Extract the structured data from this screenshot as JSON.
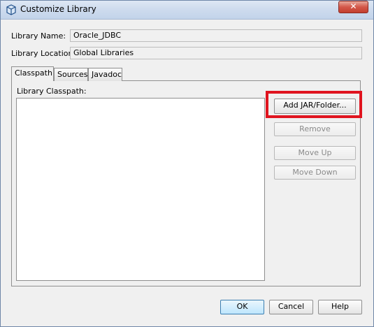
{
  "window": {
    "title": "Customize Library",
    "close_glyph": "✕"
  },
  "fields": {
    "library_name_label": "Library Name:",
    "library_name_value": "Oracle_JDBC",
    "library_location_label": "Library Location:",
    "library_location_value": "Global Libraries"
  },
  "tabs": [
    {
      "label": "Classpath",
      "active": true
    },
    {
      "label": "Sources",
      "active": false
    },
    {
      "label": "Javadoc",
      "active": false
    }
  ],
  "classpath": {
    "list_label": "Library Classpath:",
    "items": [],
    "buttons": {
      "add_jar_folder": "Add JAR/Folder...",
      "remove": "Remove",
      "move_up": "Move Up",
      "move_down": "Move Down"
    }
  },
  "footer": {
    "ok": "OK",
    "cancel": "Cancel",
    "help": "Help"
  },
  "colors": {
    "highlight": "#e0141f",
    "window_bg": "#f0f0f0"
  }
}
